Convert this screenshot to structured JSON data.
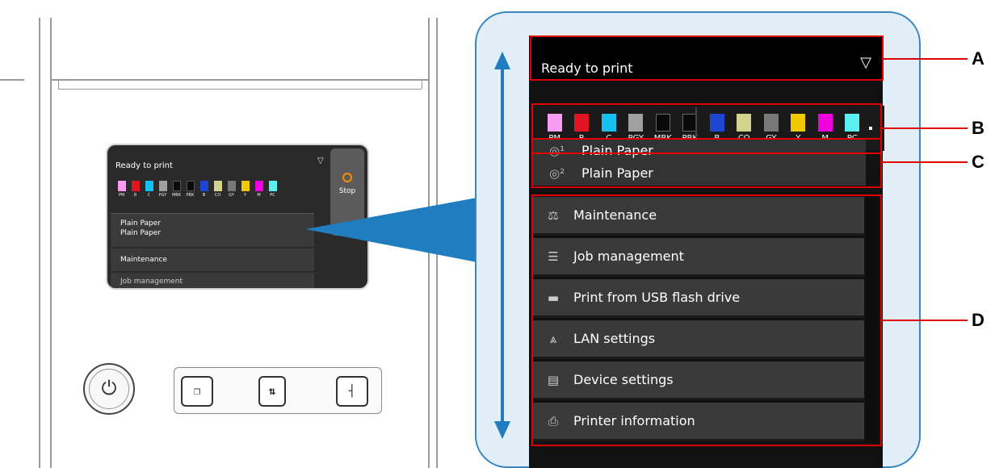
{
  "small_screen": {
    "status": "Ready to print",
    "stop_label": "Stop",
    "paper1": "Plain Paper",
    "paper2": "Plain Paper",
    "maintenance": "Maintenance",
    "job": "Job management"
  },
  "panel": {
    "status": "Ready to print",
    "wifi_icon": "wifi-icon",
    "inks": [
      {
        "label": "PM",
        "color": "#f79cf0"
      },
      {
        "label": "R",
        "color": "#e0141e"
      },
      {
        "label": "C",
        "color": "#14c0f0"
      },
      {
        "label": "PGY",
        "color": "#a0a0a0"
      },
      {
        "label": "MBK",
        "color": "#0a0a0a"
      },
      {
        "label": "PBK",
        "color": "#0a0a0a"
      },
      {
        "label": "B",
        "color": "#1e46d2"
      },
      {
        "label": "CO",
        "color": "#d2d28c"
      },
      {
        "label": "GY",
        "color": "#787878"
      },
      {
        "label": "Y",
        "color": "#f0c800"
      },
      {
        "label": "M",
        "color": "#f000dc"
      },
      {
        "label": "PC",
        "color": "#5af0f0"
      }
    ],
    "paper1": "Plain Paper",
    "paper2": "Plain Paper",
    "menu": [
      {
        "label": "Maintenance",
        "icon": "maintenance-icon"
      },
      {
        "label": "Job management",
        "icon": "job-list-icon"
      },
      {
        "label": "Print from USB flash drive",
        "icon": "usb-icon"
      },
      {
        "label": "LAN settings",
        "icon": "antenna-icon"
      },
      {
        "label": "Device settings",
        "icon": "settings-icon"
      },
      {
        "label": "Printer information",
        "icon": "printer-info-icon"
      }
    ]
  },
  "callouts": {
    "a": "A",
    "b": "B",
    "c": "C",
    "d": "D"
  },
  "colors": {
    "highlight": "#e00000",
    "panel_bg": "#e2eff8",
    "accent_blue": "#1f7dc0"
  }
}
